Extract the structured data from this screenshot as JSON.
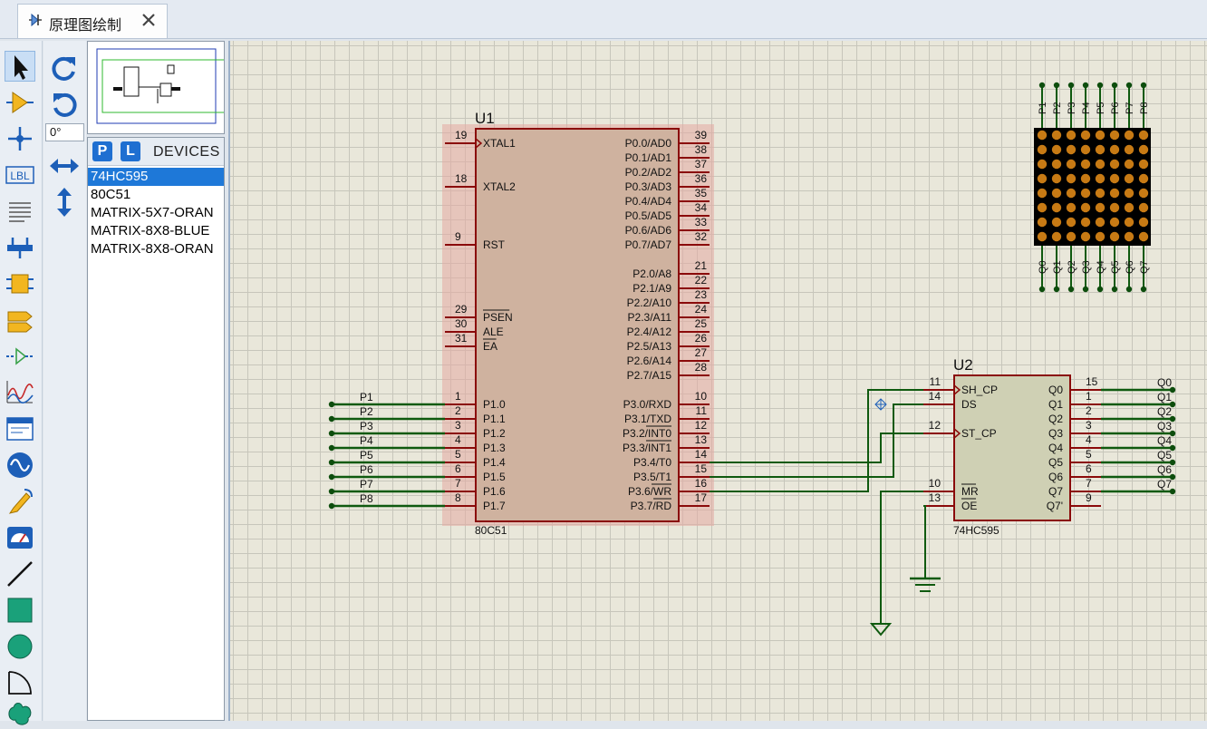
{
  "tab": {
    "title": "原理图绘制",
    "icon": "schematic-icon",
    "close_icon": "close-icon"
  },
  "toolbar": {
    "tools": [
      "select-arrow-icon",
      "component-icon",
      "junction-icon",
      "wire-label-icon",
      "text-script-icon",
      "bus-icon",
      "subcircuit-icon",
      "terminal-icon",
      "device-pin-icon",
      "graph-icon",
      "tape-recorder-icon",
      "generator-icon",
      "voltage-probe-icon",
      "virtual-instrument-icon",
      "line-icon",
      "box-icon",
      "circle-icon",
      "arc-icon",
      "path-icon"
    ],
    "label_tool": "LBL"
  },
  "rotate": {
    "angle": "0°"
  },
  "devices": {
    "pick_label": "P",
    "lib_label": "L",
    "title": "DEVICES",
    "items": [
      "74HC595",
      "80C51",
      "MATRIX-5X7-ORAN",
      "MATRIX-8X8-BLUE",
      "MATRIX-8X8-ORAN"
    ],
    "selected": "74HC595"
  },
  "schematic": {
    "u1": {
      "ref": "U1",
      "type": "80C51",
      "left_pins": [
        {
          "num": "19",
          "name": "XTAL1"
        },
        {
          "num": "18",
          "name": "XTAL2"
        },
        {
          "num": "9",
          "name": "RST"
        },
        {
          "num": "29",
          "name": "PSEN"
        },
        {
          "num": "30",
          "name": "ALE"
        },
        {
          "num": "31",
          "name": "EA"
        },
        {
          "num": "1",
          "name": "P1.0"
        },
        {
          "num": "2",
          "name": "P1.1"
        },
        {
          "num": "3",
          "name": "P1.2"
        },
        {
          "num": "4",
          "name": "P1.3"
        },
        {
          "num": "5",
          "name": "P1.4"
        },
        {
          "num": "6",
          "name": "P1.5"
        },
        {
          "num": "7",
          "name": "P1.6"
        },
        {
          "num": "8",
          "name": "P1.7"
        }
      ],
      "right_pins": [
        {
          "num": "39",
          "name": "P0.0/AD0"
        },
        {
          "num": "38",
          "name": "P0.1/AD1"
        },
        {
          "num": "37",
          "name": "P0.2/AD2"
        },
        {
          "num": "36",
          "name": "P0.3/AD3"
        },
        {
          "num": "35",
          "name": "P0.4/AD4"
        },
        {
          "num": "34",
          "name": "P0.5/AD5"
        },
        {
          "num": "33",
          "name": "P0.6/AD6"
        },
        {
          "num": "32",
          "name": "P0.7/AD7"
        },
        {
          "num": "21",
          "name": "P2.0/A8"
        },
        {
          "num": "22",
          "name": "P2.1/A9"
        },
        {
          "num": "23",
          "name": "P2.2/A10"
        },
        {
          "num": "24",
          "name": "P2.3/A11"
        },
        {
          "num": "25",
          "name": "P2.4/A12"
        },
        {
          "num": "26",
          "name": "P2.5/A13"
        },
        {
          "num": "27",
          "name": "P2.6/A14"
        },
        {
          "num": "28",
          "name": "P2.7/A15"
        },
        {
          "num": "10",
          "name": "P3.0/RXD"
        },
        {
          "num": "11",
          "name": "P3.1/TXD"
        },
        {
          "num": "12",
          "name": "P3.2/INT0"
        },
        {
          "num": "13",
          "name": "P3.3/INT1"
        },
        {
          "num": "14",
          "name": "P3.4/T0"
        },
        {
          "num": "15",
          "name": "P3.5/T1"
        },
        {
          "num": "16",
          "name": "P3.6/WR"
        },
        {
          "num": "17",
          "name": "P3.7/RD"
        }
      ]
    },
    "u2": {
      "ref": "U2",
      "type": "74HC595",
      "left_pins": [
        {
          "num": "11",
          "name": "SH_CP"
        },
        {
          "num": "14",
          "name": "DS"
        },
        {
          "num": "12",
          "name": "ST_CP"
        },
        {
          "num": "10",
          "name": "MR"
        },
        {
          "num": "13",
          "name": "OE"
        }
      ],
      "right_pins": [
        {
          "num": "15",
          "name": "Q0"
        },
        {
          "num": "1",
          "name": "Q1"
        },
        {
          "num": "2",
          "name": "Q2"
        },
        {
          "num": "3",
          "name": "Q3"
        },
        {
          "num": "4",
          "name": "Q4"
        },
        {
          "num": "5",
          "name": "Q5"
        },
        {
          "num": "6",
          "name": "Q6"
        },
        {
          "num": "7",
          "name": "Q7"
        },
        {
          "num": "9",
          "name": "Q7'"
        }
      ],
      "q_labels": [
        "Q0",
        "Q1",
        "Q2",
        "Q3",
        "Q4",
        "Q5",
        "Q6",
        "Q7"
      ]
    },
    "p_labels": [
      "P1",
      "P2",
      "P3",
      "P4",
      "P5",
      "P6",
      "P7",
      "P8"
    ],
    "matrix": {
      "top_labels": [
        "P1",
        "P2",
        "P3",
        "P4",
        "P5",
        "P6",
        "P7",
        "P8"
      ],
      "bottom_labels": [
        "Q0",
        "Q1",
        "Q2",
        "Q3",
        "Q4",
        "Q5",
        "Q6",
        "Q7"
      ],
      "led_color": "#c77a14",
      "body_color": "#000000"
    }
  }
}
